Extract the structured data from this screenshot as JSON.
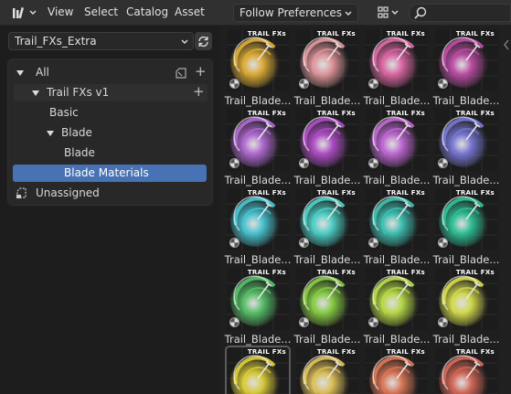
{
  "header": {
    "menus": [
      "View",
      "Select",
      "Catalog",
      "Asset"
    ],
    "import_method": "Follow Preferences",
    "search_placeholder": ""
  },
  "library": {
    "selected": "Trail_FXs_Extra"
  },
  "catalog_tree": [
    {
      "label": "All",
      "indent": 0,
      "expanded": true,
      "state": "normal"
    },
    {
      "label": "Trail FXs v1",
      "indent": 1,
      "expanded": true,
      "state": "highlight"
    },
    {
      "label": "Basic",
      "indent": 2,
      "expanded": null,
      "state": "normal"
    },
    {
      "label": "Blade",
      "indent": 2,
      "expanded": true,
      "state": "normal"
    },
    {
      "label": "Blade",
      "indent": 3,
      "expanded": null,
      "state": "normal"
    },
    {
      "label": "Blade Materials",
      "indent": 3,
      "expanded": null,
      "state": "selected"
    }
  ],
  "unassigned_label": "Unassigned",
  "assets": {
    "tag_text": "TRAIL FXs",
    "items": [
      {
        "label": "Trail_Blade...",
        "color": "#e3b037"
      },
      {
        "label": "Trail_Blade...",
        "color": "#e59aa0"
      },
      {
        "label": "Trail_Blade...",
        "color": "#e06aa8"
      },
      {
        "label": "Trail_Blade...",
        "color": "#c04fa9"
      },
      {
        "label": "Trail_Blade...",
        "color": "#b46bd6"
      },
      {
        "label": "Trail_Blade...",
        "color": "#b34fcb"
      },
      {
        "label": "Trail_Blade...",
        "color": "#c46ad8"
      },
      {
        "label": "Trail_Blade...",
        "color": "#7a79d8"
      },
      {
        "label": "Trail_Blade...",
        "color": "#4ac9d6"
      },
      {
        "label": "Trail_Blade...",
        "color": "#4ed6cc"
      },
      {
        "label": "Trail_Blade...",
        "color": "#3fc4b6"
      },
      {
        "label": "Trail_Blade...",
        "color": "#2fc49a"
      },
      {
        "label": "Trail_Blade...",
        "color": "#58c46a"
      },
      {
        "label": "Trail_Blade...",
        "color": "#8ad246"
      },
      {
        "label": "Trail_Blade...",
        "color": "#bce048"
      },
      {
        "label": "Trail_Blade...",
        "color": "#d9e04e"
      },
      {
        "label": "",
        "color": "#e0d23a"
      },
      {
        "label": "",
        "color": "#e3c55a"
      },
      {
        "label": "",
        "color": "#e07a5a"
      },
      {
        "label": "",
        "color": "#d96a5a"
      }
    ]
  }
}
